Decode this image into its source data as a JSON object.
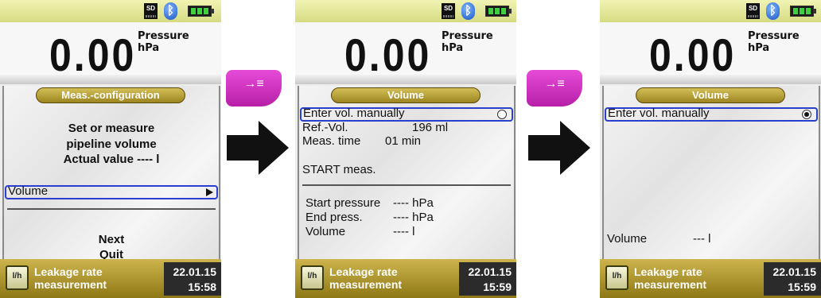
{
  "screens": [
    {
      "status": {
        "sd": "SD",
        "bluetooth": "bluetooth-icon",
        "battery": "battery-icon"
      },
      "reading": {
        "value": "0.00",
        "label": "Pressure",
        "unit": "hPa"
      },
      "menu_title": "Meas.-configuration",
      "lines": [
        "Set or measure",
        "pipeline volume",
        "Actual value  ----  l"
      ],
      "selected_item": "Volume",
      "options": [
        "Next",
        "Quit"
      ],
      "mode": {
        "line1": "Leakage rate",
        "line2": "measurement"
      },
      "date": "22.01.15",
      "time": "15:58"
    },
    {
      "status": {
        "sd": "SD",
        "bluetooth": "bluetooth-icon",
        "battery": "battery-icon"
      },
      "reading": {
        "value": "0.00",
        "label": "Pressure",
        "unit": "hPa"
      },
      "menu_title": "Volume",
      "selected_item": "Enter vol. manually",
      "radio_checked": false,
      "ref_vol": {
        "label": "Ref.-Vol.",
        "value": "196 ml"
      },
      "meas_time": {
        "label": "Meas. time",
        "value": "01 min"
      },
      "start": "START meas.",
      "start_pressure": {
        "label": "Start pressure",
        "value": "----  hPa"
      },
      "end_press": {
        "label": "End press.",
        "value": "----  hPa"
      },
      "volume": {
        "label": "Volume",
        "value": "----  l"
      },
      "mode": {
        "line1": "Leakage rate",
        "line2": "measurement"
      },
      "date": "22.01.15",
      "time": "15:59"
    },
    {
      "status": {
        "sd": "SD",
        "bluetooth": "bluetooth-icon",
        "battery": "battery-icon"
      },
      "reading": {
        "value": "0.00",
        "label": "Pressure",
        "unit": "hPa"
      },
      "menu_title": "Volume",
      "selected_item": "Enter vol. manually",
      "radio_checked": true,
      "volume": {
        "label": "Volume",
        "value": "---  l"
      },
      "mode": {
        "line1": "Leakage rate",
        "line2": "measurement"
      },
      "date": "22.01.15",
      "time": "15:59"
    }
  ],
  "softkey": {
    "icon": "confirm-enter-icon",
    "glyph": "→≡",
    "color": "#d12fc2"
  },
  "arrow_icon": "right-arrow-icon",
  "colors": {
    "selection": "#2a3fd0",
    "title_pill": "#b89d35",
    "status_bar": "#dfe49a"
  }
}
